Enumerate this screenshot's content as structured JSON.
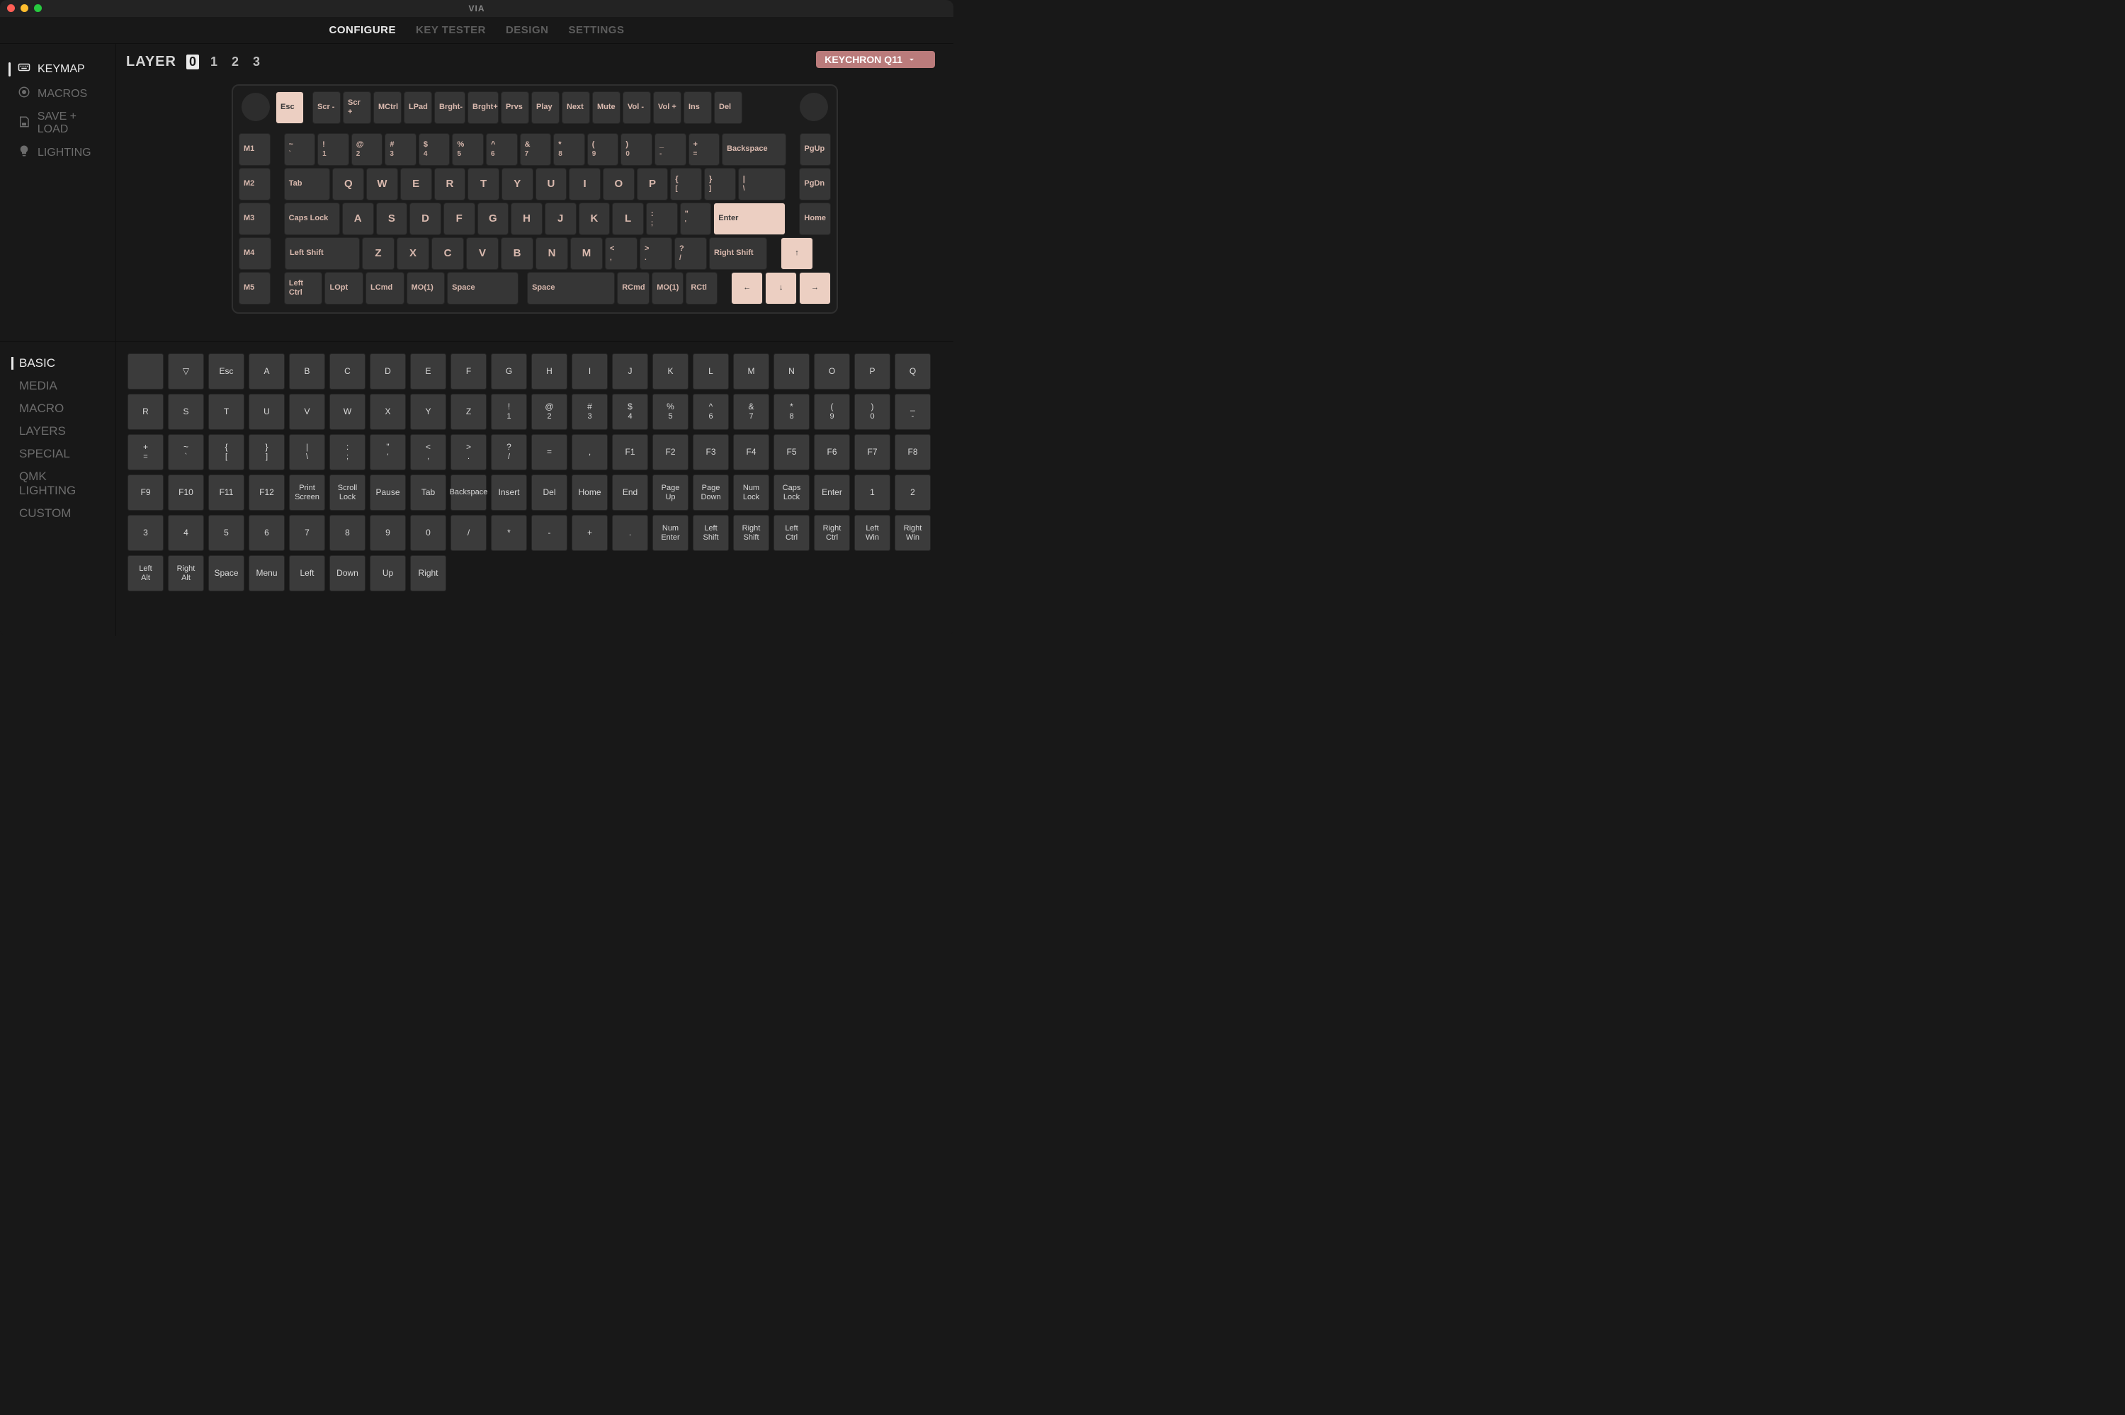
{
  "app": {
    "title": "VIA"
  },
  "tabs": [
    "CONFIGURE",
    "KEY TESTER",
    "DESIGN",
    "SETTINGS"
  ],
  "active_tab": 0,
  "sidebar": {
    "items": [
      {
        "label": "KEYMAP"
      },
      {
        "label": "MACROS"
      },
      {
        "label": "SAVE + LOAD"
      },
      {
        "label": "LIGHTING"
      }
    ],
    "active": 0
  },
  "layer": {
    "label": "LAYER",
    "values": [
      "0",
      "1",
      "2",
      "3"
    ],
    "active": 0
  },
  "device": {
    "name": "KEYCHRON Q11"
  },
  "keyboard": {
    "row0_left": [
      {
        "label": "Esc",
        "w": 40,
        "accent": true
      }
    ],
    "row0_right": [
      {
        "label": "Scr -",
        "w": 40
      },
      {
        "label": "Scr +",
        "w": 40
      },
      {
        "label": "MCtrl",
        "w": 40
      },
      {
        "label": "LPad",
        "w": 40
      },
      {
        "label": "Brght-",
        "w": 44
      },
      {
        "label": "Brght+",
        "w": 44
      },
      {
        "label": "Prvs",
        "w": 40
      },
      {
        "label": "Play",
        "w": 40
      },
      {
        "label": "Next",
        "w": 40
      },
      {
        "label": "Mute",
        "w": 40
      },
      {
        "label": "Vol -",
        "w": 40
      },
      {
        "label": "Vol +",
        "w": 40
      },
      {
        "label": "Ins",
        "w": 40
      },
      {
        "label": "Del",
        "w": 40
      }
    ],
    "row1": [
      {
        "label": "M1",
        "w": 46
      },
      {
        "gap": true
      },
      {
        "top": "~",
        "bot": "`",
        "w": 46
      },
      {
        "top": "!",
        "bot": "1",
        "w": 46
      },
      {
        "top": "@",
        "bot": "2",
        "w": 46
      },
      {
        "top": "#",
        "bot": "3",
        "w": 46
      },
      {
        "top": "$",
        "bot": "4",
        "w": 46
      },
      {
        "top": "%",
        "bot": "5",
        "w": 46
      },
      {
        "top": "^",
        "bot": "6",
        "w": 46
      },
      {
        "top": "&",
        "bot": "7",
        "w": 46
      },
      {
        "top": "*",
        "bot": "8",
        "w": 46
      },
      {
        "top": "(",
        "bot": "9",
        "w": 46
      },
      {
        "top": ")",
        "bot": "0",
        "w": 46
      },
      {
        "top": "_",
        "bot": "-",
        "w": 46
      },
      {
        "top": "+",
        "bot": "=",
        "w": 46
      },
      {
        "label": "Backspace",
        "w": 94
      },
      {
        "gap": true
      },
      {
        "label": "PgUp",
        "w": 46
      }
    ],
    "row2": [
      {
        "label": "M2",
        "w": 46
      },
      {
        "gap": true
      },
      {
        "label": "Tab",
        "w": 68
      },
      {
        "label": "Q",
        "letter": true,
        "w": 46
      },
      {
        "label": "W",
        "letter": true,
        "w": 46
      },
      {
        "label": "E",
        "letter": true,
        "w": 46
      },
      {
        "label": "R",
        "letter": true,
        "w": 46
      },
      {
        "label": "T",
        "letter": true,
        "w": 46
      },
      {
        "label": "Y",
        "letter": true,
        "w": 46
      },
      {
        "label": "U",
        "letter": true,
        "w": 46
      },
      {
        "label": "I",
        "letter": true,
        "w": 46
      },
      {
        "label": "O",
        "letter": true,
        "w": 46
      },
      {
        "label": "P",
        "letter": true,
        "w": 46
      },
      {
        "top": "{",
        "bot": "[",
        "w": 46
      },
      {
        "top": "}",
        "bot": "]",
        "w": 46
      },
      {
        "top": "|",
        "bot": "\\",
        "w": 70
      },
      {
        "gap": true
      },
      {
        "label": "PgDn",
        "w": 46
      }
    ],
    "row3": [
      {
        "label": "M3",
        "w": 46
      },
      {
        "gap": true
      },
      {
        "label": "Caps Lock",
        "w": 82
      },
      {
        "label": "A",
        "letter": true,
        "w": 46
      },
      {
        "label": "S",
        "letter": true,
        "w": 46
      },
      {
        "label": "D",
        "letter": true,
        "w": 46
      },
      {
        "label": "F",
        "letter": true,
        "w": 46
      },
      {
        "label": "G",
        "letter": true,
        "w": 46
      },
      {
        "label": "H",
        "letter": true,
        "w": 46
      },
      {
        "label": "J",
        "letter": true,
        "w": 46
      },
      {
        "label": "K",
        "letter": true,
        "w": 46
      },
      {
        "label": "L",
        "letter": true,
        "w": 46
      },
      {
        "top": ":",
        "bot": ";",
        "w": 46
      },
      {
        "top": "\"",
        "bot": "'",
        "w": 46
      },
      {
        "label": "Enter",
        "w": 106,
        "accent": true
      },
      {
        "gap": true
      },
      {
        "label": "Home",
        "w": 46
      }
    ],
    "row4": [
      {
        "label": "M4",
        "w": 46
      },
      {
        "gap": true
      },
      {
        "label": "Left Shift",
        "w": 106
      },
      {
        "label": "Z",
        "letter": true,
        "w": 46
      },
      {
        "label": "X",
        "letter": true,
        "w": 46
      },
      {
        "label": "C",
        "letter": true,
        "w": 46
      },
      {
        "label": "V",
        "letter": true,
        "w": 46
      },
      {
        "label": "B",
        "letter": true,
        "w": 46
      },
      {
        "label": "N",
        "letter": true,
        "w": 46
      },
      {
        "label": "M",
        "letter": true,
        "w": 46
      },
      {
        "top": "<",
        "bot": ",",
        "w": 46
      },
      {
        "top": ">",
        "bot": ".",
        "w": 46
      },
      {
        "top": "?",
        "bot": "/",
        "w": 46
      },
      {
        "label": "Right Shift",
        "w": 82
      },
      {
        "gap": true
      },
      {
        "label": "↑",
        "w": 46,
        "accent": true,
        "center": true
      }
    ],
    "row5": [
      {
        "label": "M5",
        "w": 46
      },
      {
        "gap": true
      },
      {
        "label": "Left Ctrl",
        "w": 56
      },
      {
        "label": "LOpt",
        "w": 56
      },
      {
        "label": "LCmd",
        "w": 56
      },
      {
        "label": "MO(1)",
        "w": 56
      },
      {
        "label": "Space",
        "w": 104
      },
      {
        "gap": true,
        "w": 6
      },
      {
        "label": "Space",
        "w": 128
      },
      {
        "label": "RCmd",
        "w": 46
      },
      {
        "label": "MO(1)",
        "w": 46
      },
      {
        "label": "RCtl",
        "w": 46
      },
      {
        "gap": true
      },
      {
        "label": "←",
        "w": 46,
        "accent": true,
        "center": true
      },
      {
        "label": "↓",
        "w": 46,
        "accent": true,
        "center": true
      },
      {
        "label": "→",
        "w": 46,
        "accent": true,
        "center": true
      }
    ]
  },
  "categories": {
    "items": [
      "BASIC",
      "MEDIA",
      "MACRO",
      "LAYERS",
      "SPECIAL",
      "QMK LIGHTING",
      "CUSTOM"
    ],
    "active": 0
  },
  "palette": [
    [
      {
        "label": ""
      },
      {
        "label": "▽"
      },
      {
        "label": "Esc"
      },
      {
        "label": "A"
      },
      {
        "label": "B"
      },
      {
        "label": "C"
      },
      {
        "label": "D"
      },
      {
        "label": "E"
      },
      {
        "label": "F"
      },
      {
        "label": "G"
      },
      {
        "label": "H"
      },
      {
        "label": "I"
      },
      {
        "label": "J"
      },
      {
        "label": "K"
      },
      {
        "label": "L"
      },
      {
        "label": "M"
      },
      {
        "label": "N"
      },
      {
        "label": "O"
      },
      {
        "label": "P"
      },
      {
        "label": "Q"
      }
    ],
    [
      {
        "label": "R"
      },
      {
        "label": "S"
      },
      {
        "label": "T"
      },
      {
        "label": "U"
      },
      {
        "label": "V"
      },
      {
        "label": "W"
      },
      {
        "label": "X"
      },
      {
        "label": "Y"
      },
      {
        "label": "Z"
      },
      {
        "top": "!",
        "bot": "1"
      },
      {
        "top": "@",
        "bot": "2"
      },
      {
        "top": "#",
        "bot": "3"
      },
      {
        "top": "$",
        "bot": "4"
      },
      {
        "top": "%",
        "bot": "5"
      },
      {
        "top": "^",
        "bot": "6"
      },
      {
        "top": "&",
        "bot": "7"
      },
      {
        "top": "*",
        "bot": "8"
      },
      {
        "top": "(",
        "bot": "9"
      },
      {
        "top": ")",
        "bot": "0"
      },
      {
        "top": "_",
        "bot": "-"
      }
    ],
    [
      {
        "top": "+",
        "bot": "="
      },
      {
        "top": "~",
        "bot": "`"
      },
      {
        "top": "{",
        "bot": "["
      },
      {
        "top": "}",
        "bot": "]"
      },
      {
        "top": "|",
        "bot": "\\"
      },
      {
        "top": ":",
        "bot": ";"
      },
      {
        "top": "\"",
        "bot": "'"
      },
      {
        "top": "<",
        "bot": ","
      },
      {
        "top": ">",
        "bot": "."
      },
      {
        "top": "?",
        "bot": "/"
      },
      {
        "label": "="
      },
      {
        "label": ","
      },
      {
        "label": "F1"
      },
      {
        "label": "F2"
      },
      {
        "label": "F3"
      },
      {
        "label": "F4"
      },
      {
        "label": "F5"
      },
      {
        "label": "F6"
      },
      {
        "label": "F7"
      },
      {
        "label": "F8"
      }
    ],
    [
      {
        "label": "F9"
      },
      {
        "label": "F10"
      },
      {
        "label": "F11"
      },
      {
        "label": "F12"
      },
      {
        "label": "Print Screen",
        "small": true
      },
      {
        "label": "Scroll Lock",
        "small": true
      },
      {
        "label": "Pause"
      },
      {
        "label": "Tab"
      },
      {
        "label": "Backspace",
        "small": true
      },
      {
        "label": "Insert"
      },
      {
        "label": "Del"
      },
      {
        "label": "Home"
      },
      {
        "label": "End"
      },
      {
        "label": "Page Up",
        "small": true
      },
      {
        "label": "Page Down",
        "small": true
      },
      {
        "label": "Num Lock",
        "small": true
      },
      {
        "label": "Caps Lock",
        "small": true
      },
      {
        "label": "Enter"
      },
      {
        "label": "1"
      },
      {
        "label": "2"
      }
    ],
    [
      {
        "label": "3"
      },
      {
        "label": "4"
      },
      {
        "label": "5"
      },
      {
        "label": "6"
      },
      {
        "label": "7"
      },
      {
        "label": "8"
      },
      {
        "label": "9"
      },
      {
        "label": "0"
      },
      {
        "label": "/"
      },
      {
        "label": "*"
      },
      {
        "label": "-"
      },
      {
        "label": "+"
      },
      {
        "label": "."
      },
      {
        "label": "Num Enter",
        "small": true
      },
      {
        "label": "Left Shift",
        "small": true
      },
      {
        "label": "Right Shift",
        "small": true
      },
      {
        "label": "Left Ctrl",
        "small": true
      },
      {
        "label": "Right Ctrl",
        "small": true
      },
      {
        "label": "Left Win",
        "small": true
      },
      {
        "label": "Right Win",
        "small": true
      }
    ],
    [
      {
        "label": "Left Alt",
        "small": true
      },
      {
        "label": "Right Alt",
        "small": true
      },
      {
        "label": "Space"
      },
      {
        "label": "Menu"
      },
      {
        "label": "Left"
      },
      {
        "label": "Down"
      },
      {
        "label": "Up"
      },
      {
        "label": "Right"
      }
    ]
  ]
}
